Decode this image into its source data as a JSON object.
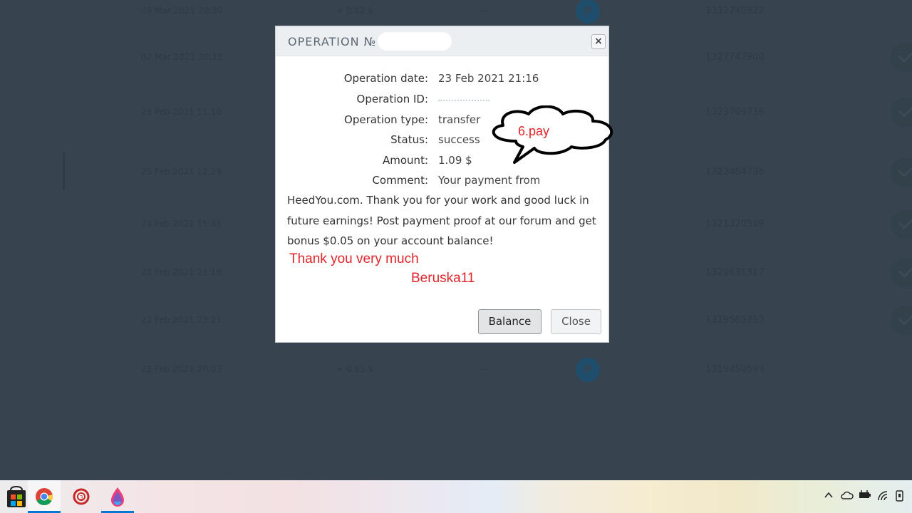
{
  "background_table": {
    "rows": [
      {
        "date": "09 Mar 2021 20:30",
        "amount": "+ 0.02 $",
        "dash": "—",
        "id": "1332745922",
        "icon": "p"
      },
      {
        "date": "02 Mar 2021 20:12",
        "amount": "",
        "dash": "",
        "id": "1327747900",
        "icon": "check"
      },
      {
        "date": "28 Feb 2021 11:10",
        "amount": "",
        "dash": "",
        "id": "1323709736",
        "icon": "check"
      },
      {
        "date": "25 Feb 2021 12:29",
        "amount": "",
        "dash": "",
        "id": "1322484736",
        "icon": "check"
      },
      {
        "date": "24 Feb 2021 15:35",
        "amount": "",
        "dash": "",
        "id": "1321320519",
        "icon": "check"
      },
      {
        "date": "23 Feb 2021 21:16",
        "amount": "",
        "dash": "",
        "id": "1320631317",
        "icon": "check"
      },
      {
        "date": "22 Feb 2021 23:21",
        "amount": "",
        "dash": "",
        "id": "1319585253",
        "icon": "check"
      },
      {
        "date": "22 Feb 2021 20:03",
        "amount": "+ 0.65 $",
        "dash": "—",
        "id": "1319450594",
        "icon": "p"
      }
    ]
  },
  "modal": {
    "title": "OPERATION №",
    "close_icon": "×",
    "details": [
      {
        "label": "Operation date:",
        "value": "23 Feb 2021 21:16"
      },
      {
        "label": "Operation ID:",
        "value": ""
      },
      {
        "label": "Operation type:",
        "value": "transfer"
      },
      {
        "label": "Status:",
        "value": "success"
      },
      {
        "label": "Amount:",
        "value": "1.09 $"
      },
      {
        "label": "Comment:",
        "value": "Your payment from"
      }
    ],
    "comment_rest": "HeedYou.com. Thank you for your work and good luck in future earnings! Post payment proof at our forum and get bonus $0.05 on your account balance!",
    "buttons": {
      "balance": "Balance",
      "close": "Close"
    }
  },
  "annotations": {
    "bubble_text": "6.pay",
    "thanks": "Thank you very much",
    "signature": "Beruska11"
  },
  "taskbar": {
    "icons": [
      "store-icon",
      "chrome-icon",
      "rewards-icon",
      "paint-drop-icon"
    ],
    "tray": {
      "chevron": "^"
    }
  },
  "colors": {
    "overlay_bg": "#37444f",
    "annotation_red": "#e0242a",
    "taskbar_accent": "#0078d4"
  }
}
